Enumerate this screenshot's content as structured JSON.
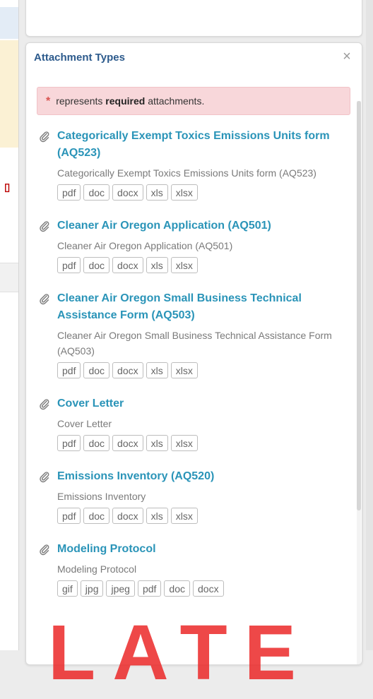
{
  "panel": {
    "title": "Attachment Types",
    "close_glyph": "×"
  },
  "notice": {
    "star": "*",
    "prefix": "represents",
    "bold": "required",
    "suffix": "attachments."
  },
  "attachments": [
    {
      "title": "Categorically Exempt Toxics Emissions Units form (AQ523)",
      "desc": "Categorically Exempt Toxics Emissions Units form (AQ523)",
      "types": [
        "pdf",
        "doc",
        "docx",
        "xls",
        "xlsx"
      ]
    },
    {
      "title": "Cleaner Air Oregon Application (AQ501)",
      "desc": "Cleaner Air Oregon Application (AQ501)",
      "types": [
        "pdf",
        "doc",
        "docx",
        "xls",
        "xlsx"
      ]
    },
    {
      "title": "Cleaner Air Oregon Small Business Technical Assistance Form (AQ503)",
      "desc": "Cleaner Air Oregon Small Business Technical Assistance Form (AQ503)",
      "types": [
        "pdf",
        "doc",
        "docx",
        "xls",
        "xlsx"
      ]
    },
    {
      "title": "Cover Letter",
      "desc": "Cover Letter",
      "types": [
        "pdf",
        "doc",
        "docx",
        "xls",
        "xlsx"
      ]
    },
    {
      "title": "Emissions Inventory (AQ520)",
      "desc": "Emissions Inventory",
      "types": [
        "pdf",
        "doc",
        "docx",
        "xls",
        "xlsx"
      ]
    },
    {
      "title": "Modeling Protocol",
      "desc": "Modeling Protocol",
      "types": [
        "gif",
        "jpg",
        "jpeg",
        "pdf",
        "doc",
        "docx"
      ]
    }
  ],
  "icons": {
    "attachment": "paperclip-icon",
    "close": "close-icon"
  },
  "colors": {
    "title": "#2c5a8c",
    "link": "#2a94b8",
    "alert_bg": "#f8d7da",
    "required_star": "#d9534f",
    "watermark": "#eb2828"
  },
  "watermark_text": "LATE"
}
